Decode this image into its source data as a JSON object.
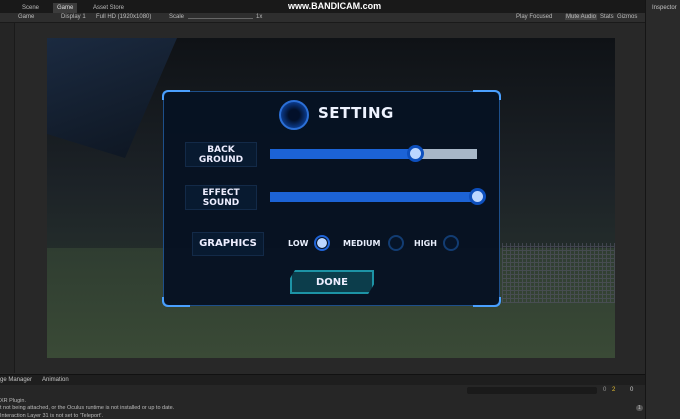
{
  "watermark": "www.BANDICAM.com",
  "tabs": [
    {
      "label": "Scene"
    },
    {
      "label": "Game"
    },
    {
      "label": "Asset Store"
    }
  ],
  "toolbar": {
    "view": "Game",
    "display": "Display 1",
    "resolution": "Full HD (1920x1080)",
    "scale_label": "Scale",
    "scale_value": "1x",
    "play_focused": "Play Focused",
    "mute_audio": "Mute Audio",
    "stats": "Stats",
    "gizmos": "Gizmos"
  },
  "inspector": {
    "label": "Inspector"
  },
  "dialog": {
    "title": "SETTING",
    "background_label": "BACK GROUND",
    "background_value": 0.7,
    "effect_label": "EFFECT SOUND",
    "effect_value": 1.0,
    "graphics_label": "GRAPHICS",
    "options": [
      "LOW",
      "MEDIUM",
      "HIGH"
    ],
    "selected": "LOW",
    "done": "DONE"
  },
  "console": {
    "tabs": [
      "ge Manager",
      "Animation"
    ],
    "counts": {
      "info": "0",
      "warn": "2",
      "error": "0"
    },
    "logs": [
      "XR Plugin.",
      "t not being attached, or the Oculus runtime is not installed or up to date.",
      "Interaction Layer 31 is not set to 'Teleport'."
    ],
    "log_count": "1"
  },
  "colors": {
    "accent": "#1c63d6",
    "done": "#1d93a5"
  }
}
